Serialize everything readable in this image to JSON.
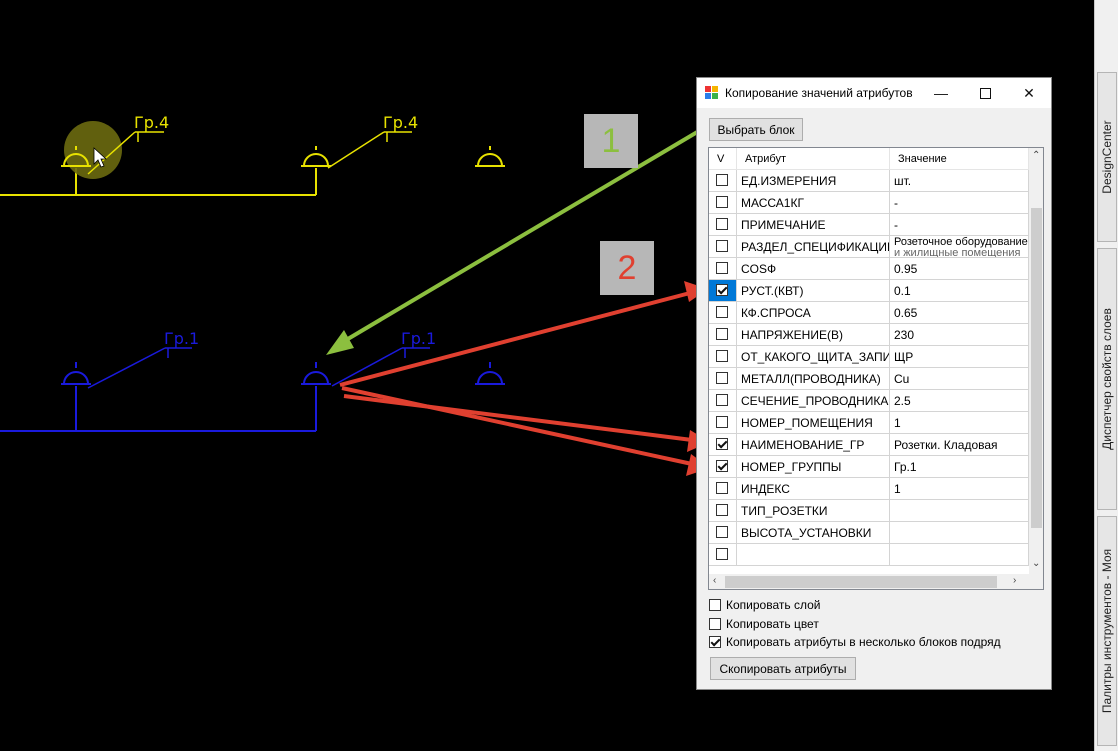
{
  "cad": {
    "labels": [
      "Гр.4",
      "Гр.4",
      "Гр.1",
      "Гр.1"
    ],
    "colors": {
      "yellow": "#e8e200",
      "blue": "#1a1adc",
      "arrow_green": "#8cbf3f",
      "arrow_red": "#e04030"
    }
  },
  "callouts": {
    "one": "1",
    "two": "2"
  },
  "palette": {
    "tabs": [
      "DesignCenter",
      "Диспетчер свойств слоев",
      "Палитры инструментов - Моя"
    ]
  },
  "dialog": {
    "title": "Копирование значений атрибутов",
    "select_block": "Выбрать блок",
    "columns": [
      "V",
      "Атрибут",
      "Значение"
    ],
    "rows": [
      {
        "checked": false,
        "attr": "ЕД.ИЗМЕРЕНИЯ",
        "value": "шт."
      },
      {
        "checked": false,
        "attr": "МАССА1КГ",
        "value": "-"
      },
      {
        "checked": false,
        "attr": "ПРИМЕЧАНИЕ",
        "value": "-"
      },
      {
        "checked": false,
        "attr": "РАЗДЕЛ_СПЕЦИФИКАЦИИ",
        "value": "Розеточное оборудование",
        "value2": "и жилищные помещения"
      },
      {
        "checked": false,
        "attr": "COSФ",
        "value": "0.95"
      },
      {
        "checked": true,
        "attr": "РУСТ.(КВТ)",
        "value": "0.1",
        "selected": true
      },
      {
        "checked": false,
        "attr": "КФ.СПРОСА",
        "value": "0.65"
      },
      {
        "checked": false,
        "attr": "НАПРЯЖЕНИЕ(В)",
        "value": "230"
      },
      {
        "checked": false,
        "attr": "ОТ_КАКОГО_ЩИТА_ЗАПИТ.",
        "value": "ЩР"
      },
      {
        "checked": false,
        "attr": "МЕТАЛЛ(ПРОВОДНИКА)",
        "value": "Cu"
      },
      {
        "checked": false,
        "attr": "СЕЧЕНИЕ_ПРОВОДНИКА",
        "value": "2.5"
      },
      {
        "checked": false,
        "attr": "НОМЕР_ПОМЕЩЕНИЯ",
        "value": "1"
      },
      {
        "checked": true,
        "attr": "НАИМЕНОВАНИЕ_ГР",
        "value": "Розетки. Кладовая"
      },
      {
        "checked": true,
        "attr": "НОМЕР_ГРУППЫ",
        "value": "Гр.1"
      },
      {
        "checked": false,
        "attr": "ИНДЕКС",
        "value": "1"
      },
      {
        "checked": false,
        "attr": "ТИП_РОЗЕТКИ",
        "value": ""
      },
      {
        "checked": false,
        "attr": "ВЫСОТА_УСТАНОВКИ",
        "value": ""
      },
      {
        "checked": false,
        "attr": "",
        "value": ""
      }
    ],
    "options": [
      {
        "checked": false,
        "label": "Копировать слой"
      },
      {
        "checked": false,
        "label": "Копировать цвет"
      },
      {
        "checked": true,
        "label": "Копировать атрибуты в несколько блоков подряд"
      }
    ],
    "copy_button": "Скопировать атрибуты"
  }
}
